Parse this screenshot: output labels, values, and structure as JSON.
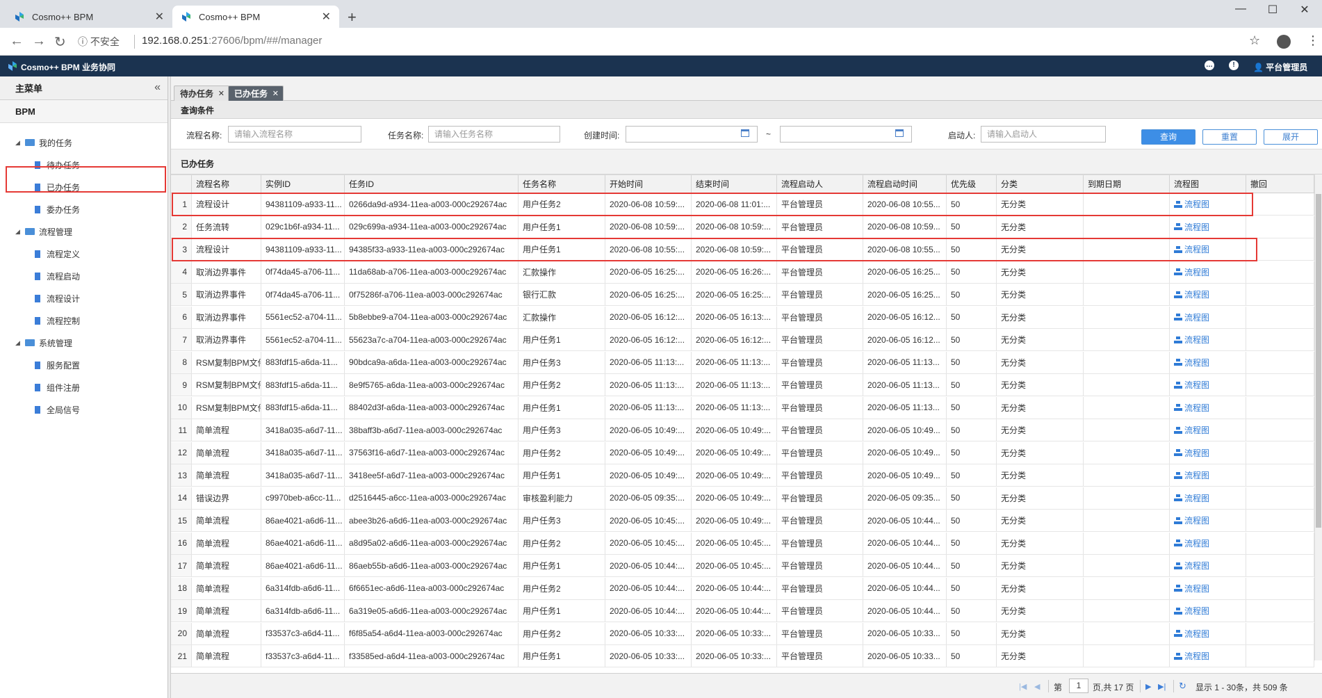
{
  "browser": {
    "tabs": [
      {
        "title": "Cosmo++ BPM",
        "active": false
      },
      {
        "title": "Cosmo++ BPM",
        "active": true
      }
    ],
    "security_label": "不安全",
    "url_host": "192.168.0.251",
    "url_rest": ":27606/bpm/##/manager"
  },
  "app": {
    "title": "Cosmo++ BPM 业务协同",
    "user": "平台管理员"
  },
  "sidebar": {
    "header": "主菜单",
    "root": "BPM",
    "items": [
      {
        "label": "我的任务",
        "type": "folder"
      },
      {
        "label": "待办任务",
        "type": "leaf"
      },
      {
        "label": "已办任务",
        "type": "leaf",
        "selected": true
      },
      {
        "label": "委办任务",
        "type": "leaf"
      },
      {
        "label": "流程管理",
        "type": "folder"
      },
      {
        "label": "流程定义",
        "type": "leaf"
      },
      {
        "label": "流程启动",
        "type": "leaf"
      },
      {
        "label": "流程设计",
        "type": "leaf"
      },
      {
        "label": "流程控制",
        "type": "leaf"
      },
      {
        "label": "系统管理",
        "type": "folder"
      },
      {
        "label": "服务配置",
        "type": "leaf"
      },
      {
        "label": "组件注册",
        "type": "leaf"
      },
      {
        "label": "全局信号",
        "type": "leaf"
      }
    ]
  },
  "main_tabs": [
    {
      "label": "待办任务",
      "active": false
    },
    {
      "label": "已办任务",
      "active": true
    }
  ],
  "query": {
    "header": "查询条件",
    "process_name_label": "流程名称:",
    "process_name_placeholder": "请输入流程名称",
    "task_name_label": "任务名称:",
    "task_name_placeholder": "请输入任务名称",
    "created_label": "创建时间:",
    "range_sep": "~",
    "starter_label": "启动人:",
    "starter_placeholder": "请输入启动人",
    "btn_query": "查询",
    "btn_reset": "重置",
    "btn_expand": "展开"
  },
  "table": {
    "header": "已办任务",
    "columns": [
      "流程名称",
      "实例ID",
      "任务ID",
      "任务名称",
      "开始时间",
      "结束时间",
      "流程启动人",
      "流程启动时间",
      "优先级",
      "分类",
      "到期日期",
      "流程图",
      "撤回"
    ],
    "link_text": "流程图",
    "rows": [
      {
        "n": "1",
        "name": "流程设计",
        "inst": "94381109-a933-11...",
        "task": "0266da9d-a934-11ea-a003-000c292674ac",
        "tname": "用户任务2",
        "start": "2020-06-08 10:59:...",
        "end": "2020-06-08 11:01:...",
        "starter": "平台管理员",
        "stime": "2020-06-08 10:55...",
        "pri": "50",
        "cat": "无分类"
      },
      {
        "n": "2",
        "name": "任务流转",
        "inst": "029c1b6f-a934-11...",
        "task": "029c699a-a934-11ea-a003-000c292674ac",
        "tname": "用户任务1",
        "start": "2020-06-08 10:59:...",
        "end": "2020-06-08 10:59:...",
        "starter": "平台管理员",
        "stime": "2020-06-08 10:59...",
        "pri": "50",
        "cat": "无分类"
      },
      {
        "n": "3",
        "name": "流程设计",
        "inst": "94381109-a933-11...",
        "task": "94385f33-a933-11ea-a003-000c292674ac",
        "tname": "用户任务1",
        "start": "2020-06-08 10:55:...",
        "end": "2020-06-08 10:59:...",
        "starter": "平台管理员",
        "stime": "2020-06-08 10:55...",
        "pri": "50",
        "cat": "无分类"
      },
      {
        "n": "4",
        "name": "取消边界事件",
        "inst": "0f74da45-a706-11...",
        "task": "11da68ab-a706-11ea-a003-000c292674ac",
        "tname": "汇款操作",
        "start": "2020-06-05 16:25:...",
        "end": "2020-06-05 16:26:...",
        "starter": "平台管理员",
        "stime": "2020-06-05 16:25...",
        "pri": "50",
        "cat": "无分类"
      },
      {
        "n": "5",
        "name": "取消边界事件",
        "inst": "0f74da45-a706-11...",
        "task": "0f75286f-a706-11ea-a003-000c292674ac",
        "tname": "银行汇款",
        "start": "2020-06-05 16:25:...",
        "end": "2020-06-05 16:25:...",
        "starter": "平台管理员",
        "stime": "2020-06-05 16:25...",
        "pri": "50",
        "cat": "无分类"
      },
      {
        "n": "6",
        "name": "取消边界事件",
        "inst": "5561ec52-a704-11...",
        "task": "5b8ebbe9-a704-11ea-a003-000c292674ac",
        "tname": "汇款操作",
        "start": "2020-06-05 16:12:...",
        "end": "2020-06-05 16:13:...",
        "starter": "平台管理员",
        "stime": "2020-06-05 16:12...",
        "pri": "50",
        "cat": "无分类"
      },
      {
        "n": "7",
        "name": "取消边界事件",
        "inst": "5561ec52-a704-11...",
        "task": "55623a7c-a704-11ea-a003-000c292674ac",
        "tname": "用户任务1",
        "start": "2020-06-05 16:12:...",
        "end": "2020-06-05 16:12:...",
        "starter": "平台管理员",
        "stime": "2020-06-05 16:12...",
        "pri": "50",
        "cat": "无分类"
      },
      {
        "n": "8",
        "name": "RSM复制BPM文件",
        "inst": "883fdf15-a6da-11...",
        "task": "90bdca9a-a6da-11ea-a003-000c292674ac",
        "tname": "用户任务3",
        "start": "2020-06-05 11:13:...",
        "end": "2020-06-05 11:13:...",
        "starter": "平台管理员",
        "stime": "2020-06-05 11:13...",
        "pri": "50",
        "cat": "无分类"
      },
      {
        "n": "9",
        "name": "RSM复制BPM文件",
        "inst": "883fdf15-a6da-11...",
        "task": "8e9f5765-a6da-11ea-a003-000c292674ac",
        "tname": "用户任务2",
        "start": "2020-06-05 11:13:...",
        "end": "2020-06-05 11:13:...",
        "starter": "平台管理员",
        "stime": "2020-06-05 11:13...",
        "pri": "50",
        "cat": "无分类"
      },
      {
        "n": "10",
        "name": "RSM复制BPM文件",
        "inst": "883fdf15-a6da-11...",
        "task": "88402d3f-a6da-11ea-a003-000c292674ac",
        "tname": "用户任务1",
        "start": "2020-06-05 11:13:...",
        "end": "2020-06-05 11:13:...",
        "starter": "平台管理员",
        "stime": "2020-06-05 11:13...",
        "pri": "50",
        "cat": "无分类"
      },
      {
        "n": "11",
        "name": "简单流程",
        "inst": "3418a035-a6d7-11...",
        "task": "38baff3b-a6d7-11ea-a003-000c292674ac",
        "tname": "用户任务3",
        "start": "2020-06-05 10:49:...",
        "end": "2020-06-05 10:49:...",
        "starter": "平台管理员",
        "stime": "2020-06-05 10:49...",
        "pri": "50",
        "cat": "无分类"
      },
      {
        "n": "12",
        "name": "简单流程",
        "inst": "3418a035-a6d7-11...",
        "task": "37563f16-a6d7-11ea-a003-000c292674ac",
        "tname": "用户任务2",
        "start": "2020-06-05 10:49:...",
        "end": "2020-06-05 10:49:...",
        "starter": "平台管理员",
        "stime": "2020-06-05 10:49...",
        "pri": "50",
        "cat": "无分类"
      },
      {
        "n": "13",
        "name": "简单流程",
        "inst": "3418a035-a6d7-11...",
        "task": "3418ee5f-a6d7-11ea-a003-000c292674ac",
        "tname": "用户任务1",
        "start": "2020-06-05 10:49:...",
        "end": "2020-06-05 10:49:...",
        "starter": "平台管理员",
        "stime": "2020-06-05 10:49...",
        "pri": "50",
        "cat": "无分类"
      },
      {
        "n": "14",
        "name": "错误边界",
        "inst": "c9970beb-a6cc-11...",
        "task": "d2516445-a6cc-11ea-a003-000c292674ac",
        "tname": "审核盈利能力",
        "start": "2020-06-05 09:35:...",
        "end": "2020-06-05 10:49:...",
        "starter": "平台管理员",
        "stime": "2020-06-05 09:35...",
        "pri": "50",
        "cat": "无分类"
      },
      {
        "n": "15",
        "name": "简单流程",
        "inst": "86ae4021-a6d6-11...",
        "task": "abee3b26-a6d6-11ea-a003-000c292674ac",
        "tname": "用户任务3",
        "start": "2020-06-05 10:45:...",
        "end": "2020-06-05 10:49:...",
        "starter": "平台管理员",
        "stime": "2020-06-05 10:44...",
        "pri": "50",
        "cat": "无分类"
      },
      {
        "n": "16",
        "name": "简单流程",
        "inst": "86ae4021-a6d6-11...",
        "task": "a8d95a02-a6d6-11ea-a003-000c292674ac",
        "tname": "用户任务2",
        "start": "2020-06-05 10:45:...",
        "end": "2020-06-05 10:45:...",
        "starter": "平台管理员",
        "stime": "2020-06-05 10:44...",
        "pri": "50",
        "cat": "无分类"
      },
      {
        "n": "17",
        "name": "简单流程",
        "inst": "86ae4021-a6d6-11...",
        "task": "86aeb55b-a6d6-11ea-a003-000c292674ac",
        "tname": "用户任务1",
        "start": "2020-06-05 10:44:...",
        "end": "2020-06-05 10:45:...",
        "starter": "平台管理员",
        "stime": "2020-06-05 10:44...",
        "pri": "50",
        "cat": "无分类"
      },
      {
        "n": "18",
        "name": "简单流程",
        "inst": "6a314fdb-a6d6-11...",
        "task": "6f6651ec-a6d6-11ea-a003-000c292674ac",
        "tname": "用户任务2",
        "start": "2020-06-05 10:44:...",
        "end": "2020-06-05 10:44:...",
        "starter": "平台管理员",
        "stime": "2020-06-05 10:44...",
        "pri": "50",
        "cat": "无分类"
      },
      {
        "n": "19",
        "name": "简单流程",
        "inst": "6a314fdb-a6d6-11...",
        "task": "6a319e05-a6d6-11ea-a003-000c292674ac",
        "tname": "用户任务1",
        "start": "2020-06-05 10:44:...",
        "end": "2020-06-05 10:44:...",
        "starter": "平台管理员",
        "stime": "2020-06-05 10:44...",
        "pri": "50",
        "cat": "无分类"
      },
      {
        "n": "20",
        "name": "简单流程",
        "inst": "f33537c3-a6d4-11...",
        "task": "f6f85a54-a6d4-11ea-a003-000c292674ac",
        "tname": "用户任务2",
        "start": "2020-06-05 10:33:...",
        "end": "2020-06-05 10:33:...",
        "starter": "平台管理员",
        "stime": "2020-06-05 10:33...",
        "pri": "50",
        "cat": "无分类"
      },
      {
        "n": "21",
        "name": "简单流程",
        "inst": "f33537c3-a6d4-11...",
        "task": "f33585ed-a6d4-11ea-a003-000c292674ac",
        "tname": "用户任务1",
        "start": "2020-06-05 10:33:...",
        "end": "2020-06-05 10:33:...",
        "starter": "平台管理员",
        "stime": "2020-06-05 10:33...",
        "pri": "50",
        "cat": "无分类"
      }
    ]
  },
  "pager": {
    "page_prefix": "第",
    "page_value": "1",
    "page_suffix": "页,共 17 页",
    "summary": "显示 1 - 30条，共 509 条"
  },
  "colors": {
    "header_bg": "#1b3350",
    "accent": "#3d8ee6",
    "highlight": "#e53935"
  }
}
